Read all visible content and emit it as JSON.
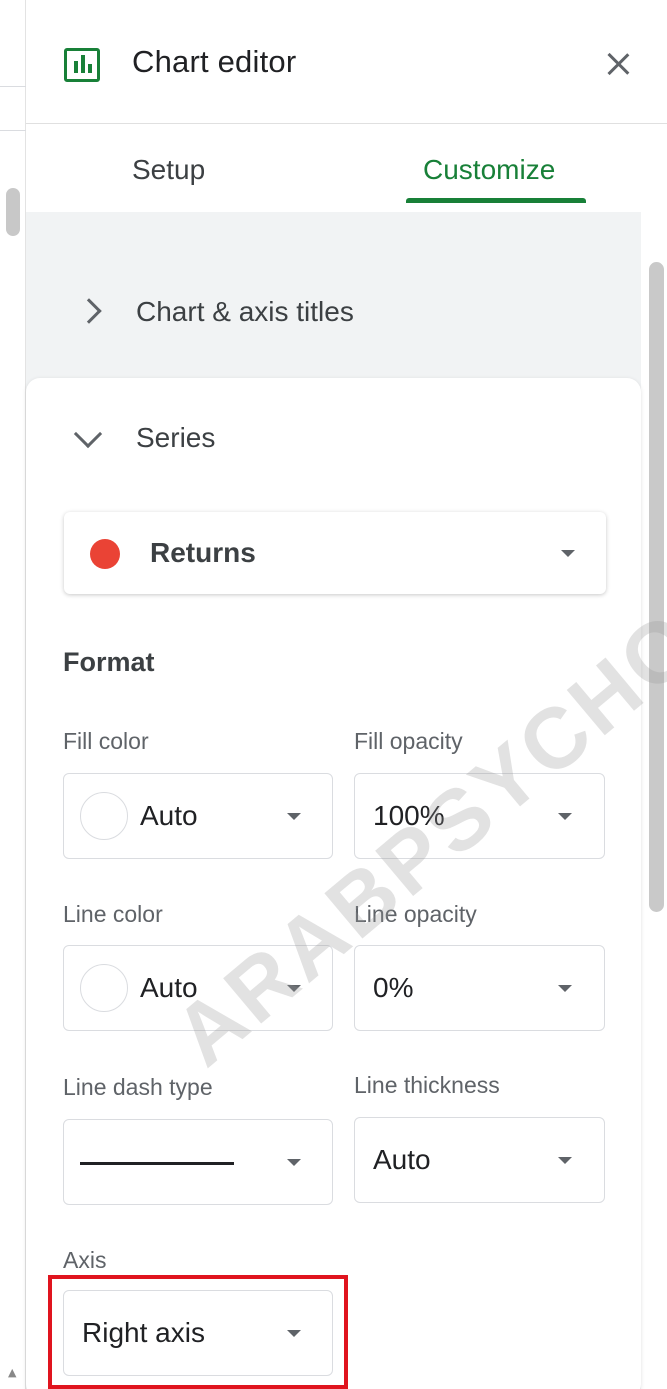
{
  "header": {
    "title": "Chart editor",
    "icon": "bar-chart-icon",
    "close_icon": "close-icon"
  },
  "tabs": [
    {
      "label": "Setup",
      "active": false
    },
    {
      "label": "Customize",
      "active": true
    }
  ],
  "sections": {
    "chart_axis_titles": {
      "label": "Chart & axis titles",
      "expanded": false
    },
    "series": {
      "label": "Series",
      "expanded": true
    }
  },
  "series_select": {
    "value": "Returns",
    "dot_color": "#ea4335"
  },
  "format": {
    "heading": "Format",
    "fill_color": {
      "label": "Fill color",
      "value": "Auto"
    },
    "fill_opacity": {
      "label": "Fill opacity",
      "value": "100%"
    },
    "line_color": {
      "label": "Line color",
      "value": "Auto"
    },
    "line_opacity": {
      "label": "Line opacity",
      "value": "0%"
    },
    "line_dash_type": {
      "label": "Line dash type",
      "value": "solid"
    },
    "line_thickness": {
      "label": "Line thickness",
      "value": "Auto"
    },
    "axis": {
      "label": "Axis",
      "value": "Right axis"
    }
  },
  "watermark": "ARABPSYCHO",
  "colors": {
    "accent": "#188038",
    "highlight": "#e0141e",
    "series_dot": "#ea4335"
  }
}
